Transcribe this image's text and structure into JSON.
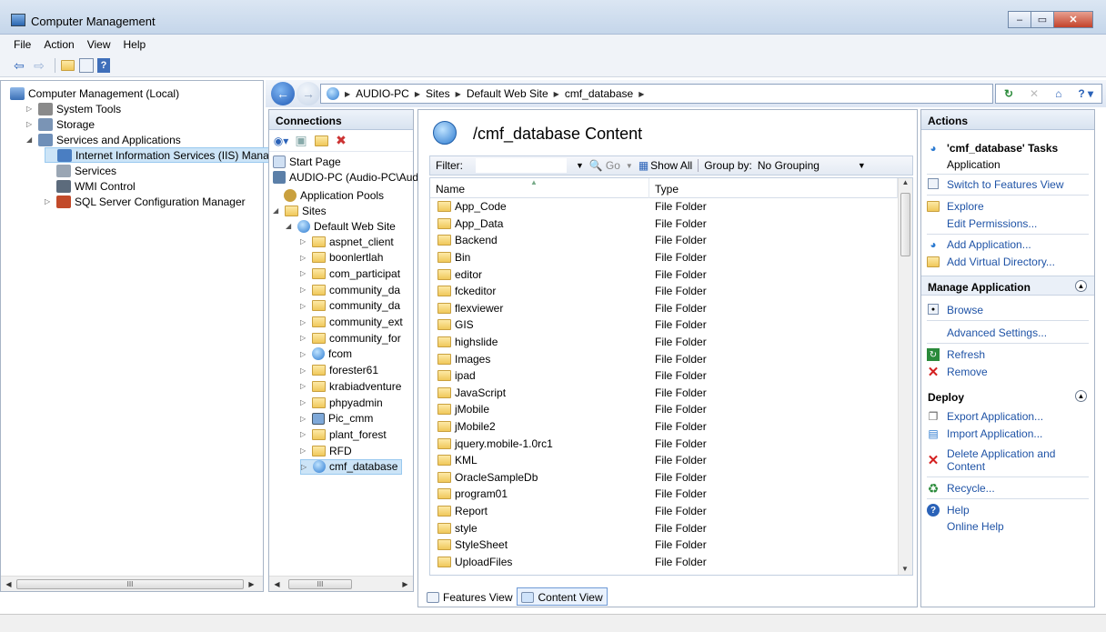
{
  "window": {
    "title": "Computer Management",
    "min": "–",
    "max": "▭",
    "close": "✕"
  },
  "menu": [
    "File",
    "Action",
    "View",
    "Help"
  ],
  "left_tree": {
    "root": "Computer Management (Local)",
    "items": [
      {
        "label": "System Tools",
        "indent": 1,
        "expander": "▷",
        "icon": "tools-icon"
      },
      {
        "label": "Storage",
        "indent": 1,
        "expander": "▷",
        "icon": "storage-icon"
      },
      {
        "label": "Services and Applications",
        "indent": 1,
        "expander": "◢",
        "icon": "services-apps-icon"
      },
      {
        "label": "Internet Information Services (IIS) Manage",
        "indent": 2,
        "expander": "",
        "icon": "iis-icon",
        "selected": true
      },
      {
        "label": "Services",
        "indent": 2,
        "expander": "",
        "icon": "services-icon"
      },
      {
        "label": "WMI Control",
        "indent": 2,
        "expander": "",
        "icon": "wmi-icon"
      },
      {
        "label": "SQL Server Configuration Manager",
        "indent": 2,
        "expander": "▷",
        "icon": "sql-icon"
      }
    ],
    "scroll_glyph": "III"
  },
  "address": {
    "crumbs": [
      "AUDIO-PC",
      "Sites",
      "Default Web Site",
      "cmf_database"
    ]
  },
  "connections": {
    "header": "Connections",
    "start_page": "Start Page",
    "server": "AUDIO-PC (Audio-PC\\Aud",
    "app_pools": "Application Pools",
    "sites": "Sites",
    "default_site": "Default Web Site",
    "children": [
      "aspnet_client",
      "boonlertlah",
      "com_participat",
      "community_da",
      "community_da",
      "community_ext",
      "community_for",
      "fcom",
      "forester61",
      "krabiadventure",
      "phpyadmin",
      "Pic_cmm",
      "plant_forest",
      "RFD",
      "cmf_database"
    ],
    "scroll_glyph": "III"
  },
  "content": {
    "title": "/cmf_database Content",
    "filter_label": "Filter:",
    "go_label": "Go",
    "show_all": "Show All",
    "group_by_label": "Group by:",
    "group_by_value": "No Grouping",
    "col_name": "Name",
    "col_type": "Type",
    "rows": [
      {
        "name": "App_Code",
        "type": "File Folder"
      },
      {
        "name": "App_Data",
        "type": "File Folder"
      },
      {
        "name": "Backend",
        "type": "File Folder"
      },
      {
        "name": "Bin",
        "type": "File Folder"
      },
      {
        "name": "editor",
        "type": "File Folder"
      },
      {
        "name": "fckeditor",
        "type": "File Folder"
      },
      {
        "name": "flexviewer",
        "type": "File Folder"
      },
      {
        "name": "GIS",
        "type": "File Folder"
      },
      {
        "name": "highslide",
        "type": "File Folder"
      },
      {
        "name": "Images",
        "type": "File Folder"
      },
      {
        "name": "ipad",
        "type": "File Folder"
      },
      {
        "name": "JavaScript",
        "type": "File Folder"
      },
      {
        "name": "jMobile",
        "type": "File Folder"
      },
      {
        "name": "jMobile2",
        "type": "File Folder"
      },
      {
        "name": "jquery.mobile-1.0rc1",
        "type": "File Folder"
      },
      {
        "name": "KML",
        "type": "File Folder"
      },
      {
        "name": "OracleSampleDb",
        "type": "File Folder"
      },
      {
        "name": "program01",
        "type": "File Folder"
      },
      {
        "name": "Report",
        "type": "File Folder"
      },
      {
        "name": "style",
        "type": "File Folder"
      },
      {
        "name": "StyleSheet",
        "type": "File Folder"
      },
      {
        "name": "UploadFiles",
        "type": "File Folder"
      }
    ],
    "features_view": "Features View",
    "content_view": "Content View"
  },
  "actions": {
    "header": "Actions",
    "tasks_title": "'cmf_database' Tasks",
    "tasks_sub": "Application",
    "switch": "Switch to Features View",
    "explore": "Explore",
    "edit_perms": "Edit Permissions...",
    "add_app": "Add Application...",
    "add_vdir": "Add Virtual Directory...",
    "manage_app": "Manage Application",
    "browse": "Browse",
    "adv_settings": "Advanced Settings...",
    "refresh": "Refresh",
    "remove": "Remove",
    "deploy": "Deploy",
    "export_app": "Export Application...",
    "import_app": "Import Application...",
    "delete_app_1": "Delete Application and",
    "delete_app_2": "Content",
    "recycle": "Recycle...",
    "help": "Help",
    "online_help": "Online Help"
  }
}
